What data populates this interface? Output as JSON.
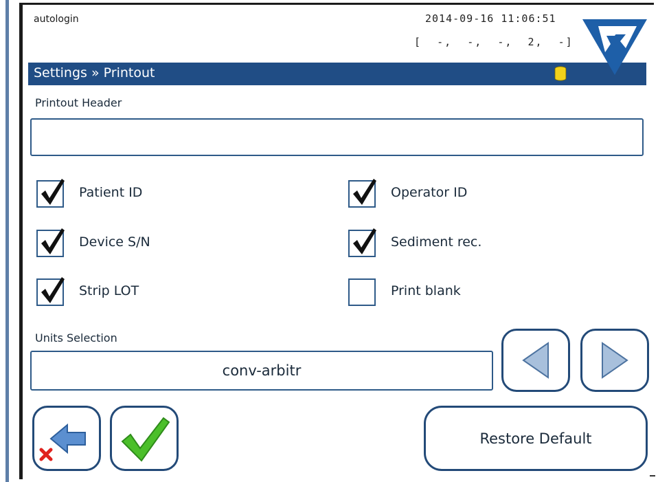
{
  "status": {
    "user": "autologin",
    "datetime": "2014-09-16 11:06:51",
    "codes": "[  -,  -,  -,  2,  -]"
  },
  "title_bar": {
    "title": "Settings » Printout",
    "database_icon": "database-icon",
    "database_icon_color": "#f2d21b"
  },
  "logo": {
    "icon": "company-logo"
  },
  "printout_header": {
    "label": "Printout Header",
    "value": "",
    "placeholder": ""
  },
  "options": {
    "patient_id": {
      "label": "Patient ID",
      "checked": true
    },
    "device_sn": {
      "label": "Device S/N",
      "checked": true
    },
    "strip_lot": {
      "label": "Strip LOT",
      "checked": true
    },
    "operator_id": {
      "label": "Operator ID",
      "checked": true
    },
    "sediment_rec": {
      "label": "Sediment rec.",
      "checked": true
    },
    "print_blank": {
      "label": "Print blank",
      "checked": false
    }
  },
  "units": {
    "label": "Units Selection",
    "value": "conv-arbitr",
    "prev_icon": "triangle-left-icon",
    "next_icon": "triangle-right-icon"
  },
  "actions": {
    "cancel_icon": "back-cancel-icon",
    "confirm_icon": "check-icon",
    "restore_label": "Restore Default"
  },
  "colors": {
    "accent": "#204d85",
    "border": "#234a78",
    "confirm_green": "#4bbf2a",
    "cancel_red": "#e0221e"
  }
}
